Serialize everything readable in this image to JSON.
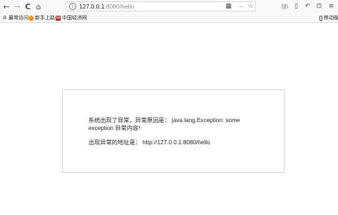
{
  "browser": {
    "nav": {
      "back": "←",
      "forward": "→",
      "reload": "C",
      "home": "⌂"
    },
    "url": {
      "host": "127.0.0.1",
      "rest": ":8080/hello"
    },
    "url_icons": {
      "info": "i",
      "qr": "▦",
      "more": "···",
      "star": "☆"
    },
    "right_icons": [
      "library-icon",
      "sidebar-icon",
      "undo-icon",
      "screenshot-icon",
      "menu-icon"
    ],
    "right_glyphs": [
      "|||\\",
      "▯",
      "↶",
      "⊡",
      "≡"
    ]
  },
  "bookmarks": {
    "items": [
      {
        "label": "最常访问",
        "icon": "gear-icon"
      },
      {
        "label": "新手上路",
        "icon": "firefox-icon"
      },
      {
        "label": "中国经济网",
        "icon": "ce-icon"
      }
    ],
    "mobile": "移动版"
  },
  "page": {
    "message": "系统出现了异常，异常原因是： java.lang.Exception: some exception 异常内容!",
    "address": "出现异常的地址是： http://127.0.0.1:8080/hello"
  }
}
